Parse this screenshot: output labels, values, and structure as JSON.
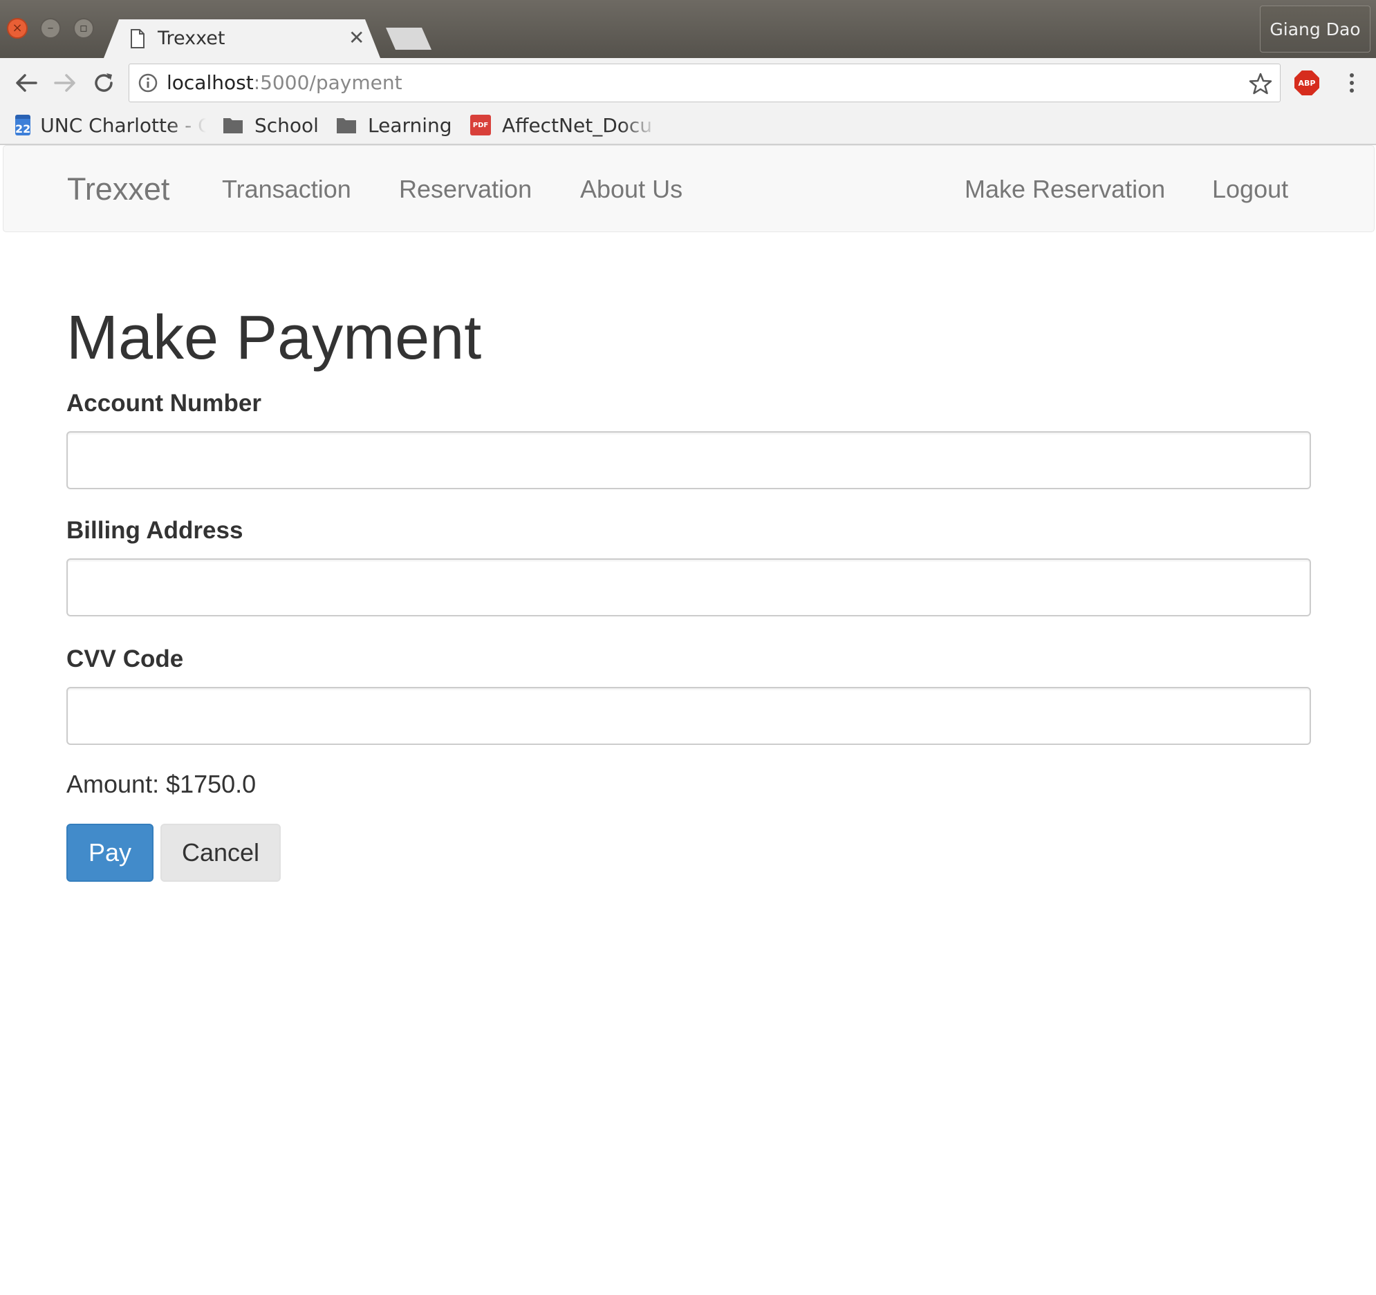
{
  "browser": {
    "tab_title": "Trexxet",
    "profile_name": "Giang Dao",
    "url_host": "localhost",
    "url_rest": ":5000/payment",
    "bookmarks": [
      {
        "label": "UNC Charlotte - C",
        "icon": "calendar-icon",
        "icon_text": "22"
      },
      {
        "label": "School",
        "icon": "folder-icon"
      },
      {
        "label": "Learning",
        "icon": "folder-icon"
      },
      {
        "label": "AffectNet_Docu",
        "icon": "pdf-icon",
        "icon_text": "PDF"
      }
    ],
    "abp_label": "ABP"
  },
  "navbar": {
    "brand": "Trexxet",
    "left_links": [
      "Transaction",
      "Reservation",
      "About Us"
    ],
    "right_links": [
      "Make Reservation",
      "Logout"
    ]
  },
  "form": {
    "title": "Make Payment",
    "fields": [
      {
        "label": "Account Number",
        "value": ""
      },
      {
        "label": "Billing Address",
        "value": ""
      },
      {
        "label": "CVV Code",
        "value": ""
      }
    ],
    "amount_text": "Amount: $1750.0",
    "pay_label": "Pay",
    "cancel_label": "Cancel"
  },
  "colors": {
    "primary": "#428bca",
    "navbar_bg": "#f8f8f8",
    "nav_link": "#777777",
    "text": "#333333"
  }
}
